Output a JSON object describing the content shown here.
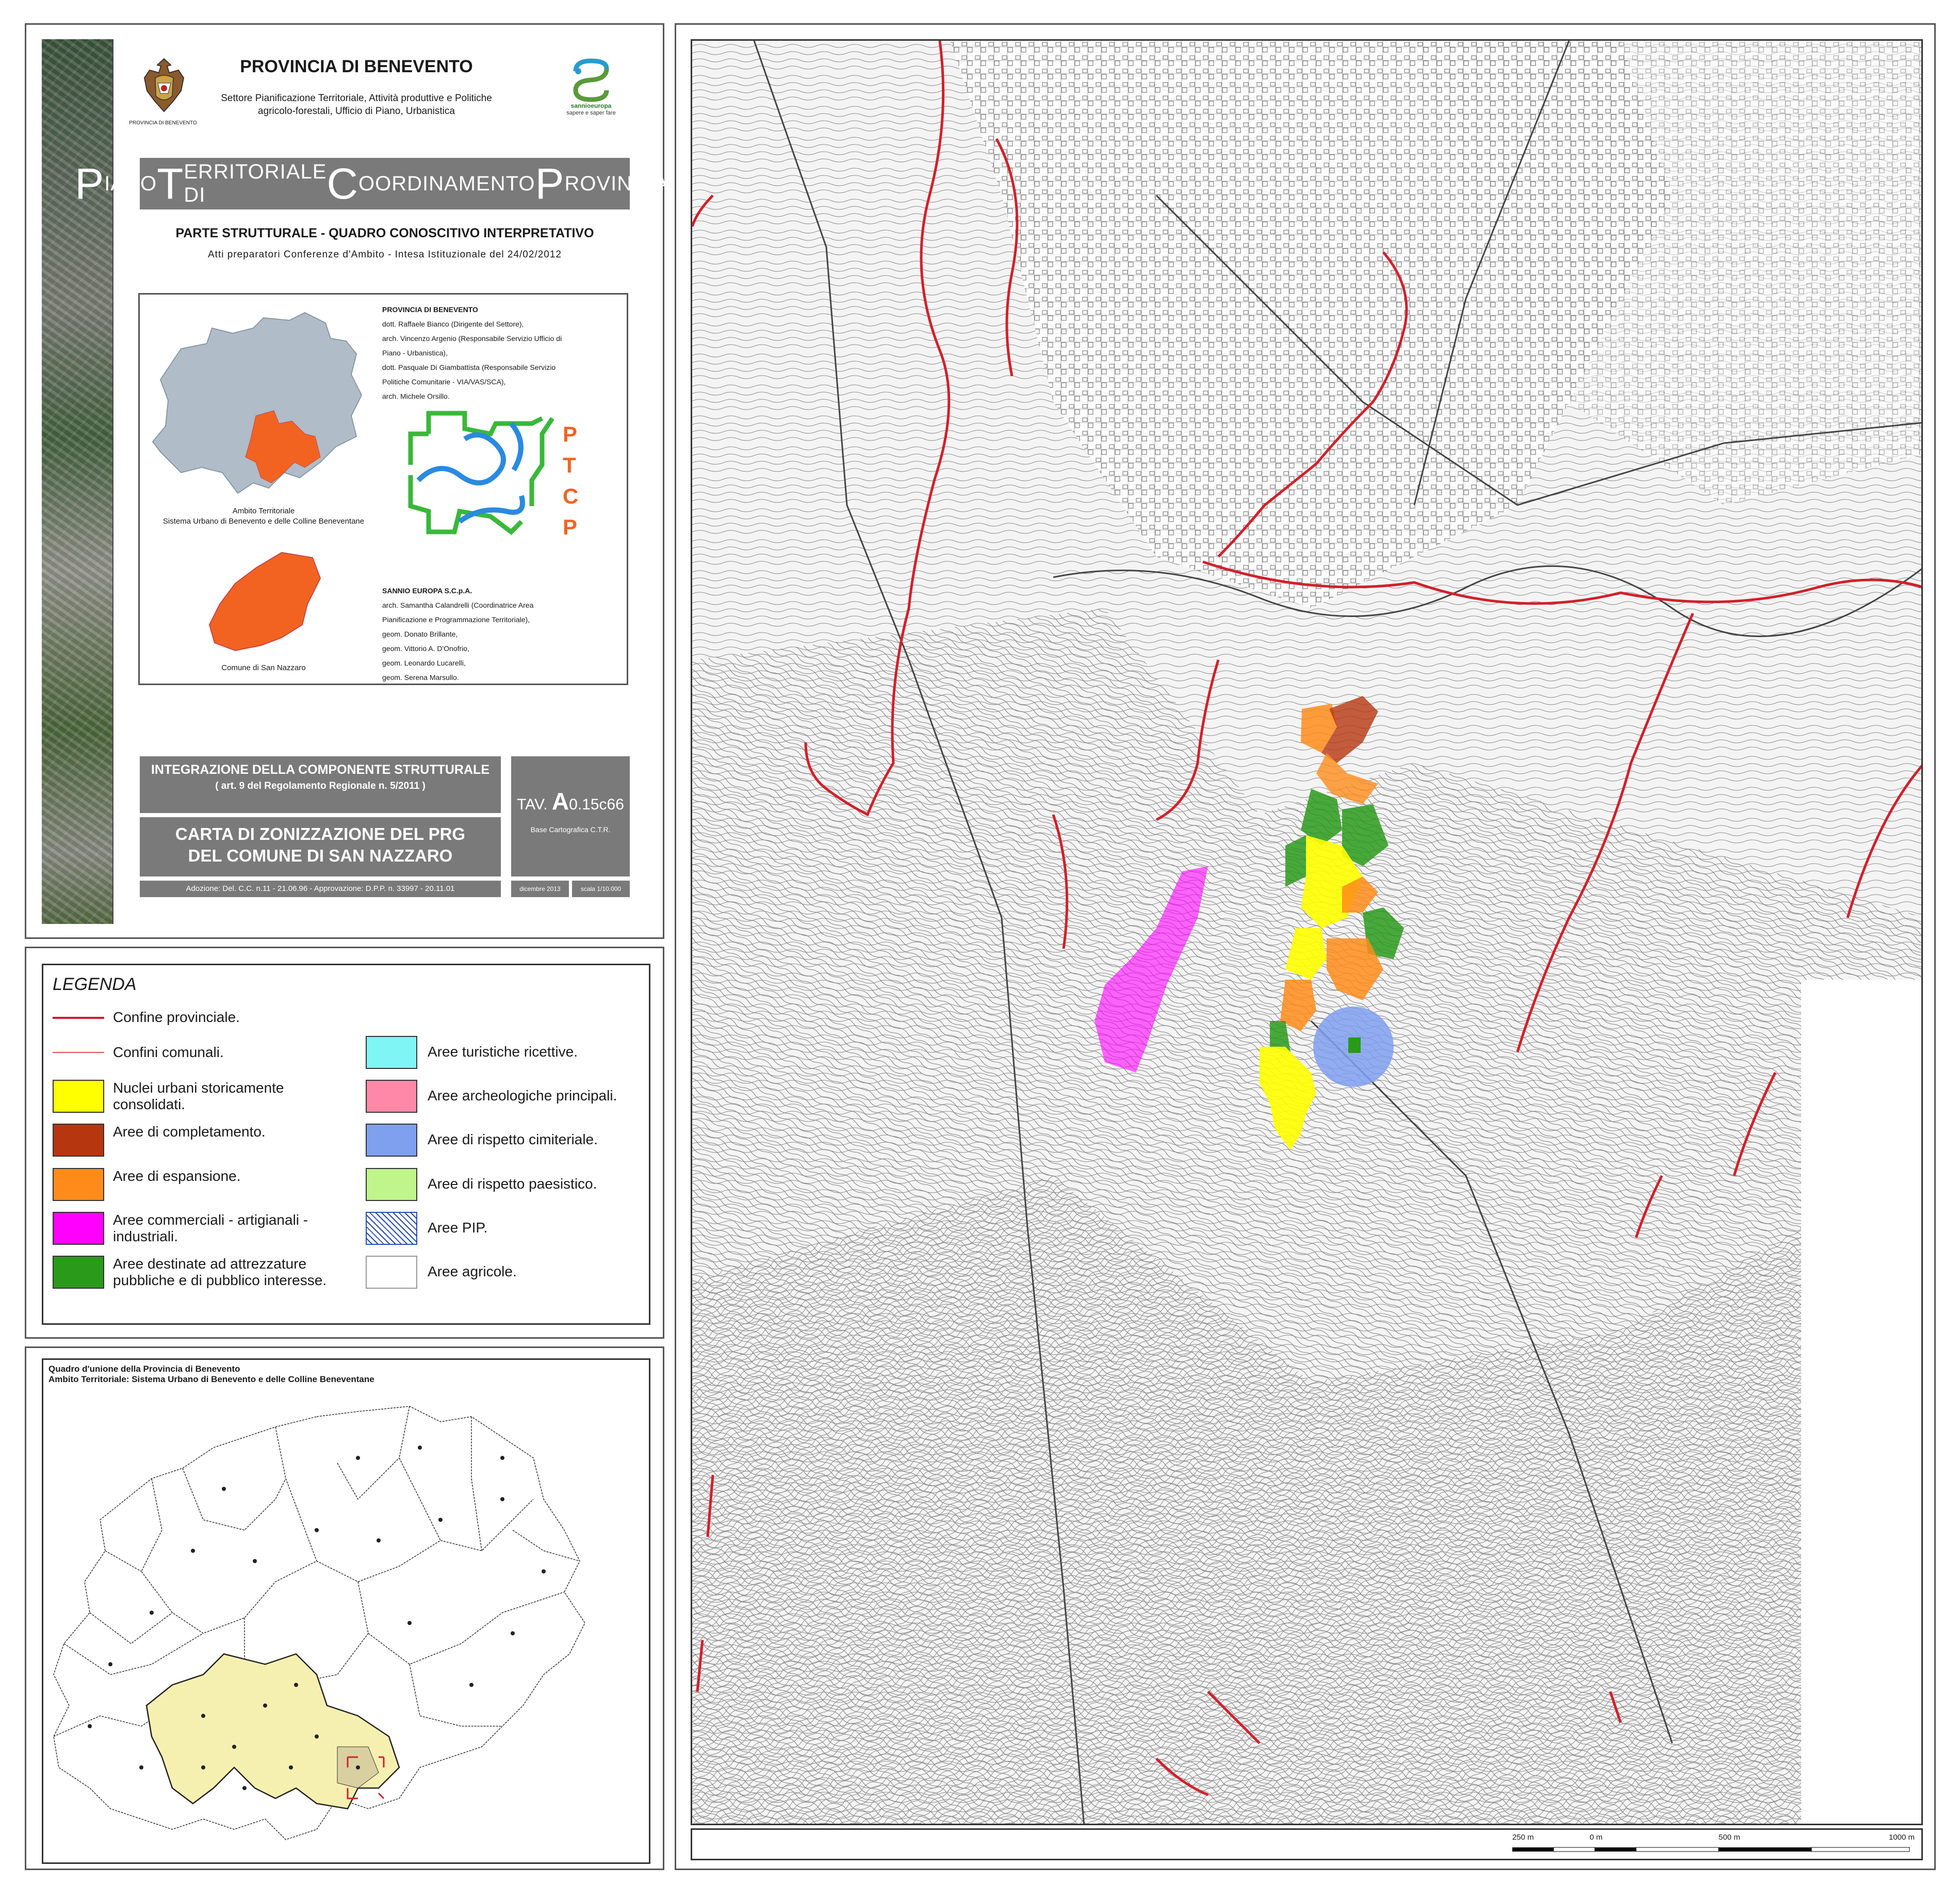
{
  "header": {
    "province": "PROVINCIA DI BENEVENTO",
    "department": "Settore Pianificazione Territoriale, Attività produttive e Politiche agricolo-forestali, Ufficio di Piano, Urbanistica",
    "crest_caption": "PROVINCIA DI BENEVENTO",
    "partner_logo_caption": "sannioeuropa",
    "partner_logo_motto": "sapere e saper fare"
  },
  "plan": {
    "banner": [
      {
        "initial": "P",
        "rest": "IANO "
      },
      {
        "initial": "T",
        "rest": "ERRITORIALE DI "
      },
      {
        "initial": "C",
        "rest": "OORDINAMENTO "
      },
      {
        "initial": "P",
        "rest": "ROVINCIALE"
      }
    ],
    "section_title": "PARTE STRUTTURALE - QUADRO CONOSCITIVO INTERPRETATIVO",
    "atti": "Atti preparatori Conferenze d'Ambito - Intesa Istituzionale del 24/02/2012"
  },
  "info_box": {
    "ambito_caption_1": "Ambito Territoriale",
    "ambito_caption_2": "Sistema Urbano di Benevento e delle Colline Beneventane",
    "comune_caption": "Comune di San Nazzaro",
    "ptcp_letters": [
      "P",
      "T",
      "C",
      "P"
    ],
    "province_credits_title": "PROVINCIA DI BENEVENTO",
    "province_credits": [
      "dott. Raffaele Bianco (Dirigente del Settore),",
      "arch. Vincenzo Argenio (Responsabile Servizio Ufficio di",
      "Piano - Urbanistica),",
      "dott. Pasquale Di Giambattista (Responsabile Servizio",
      "Politiche Comunitarie - VIA/VAS/SCA),",
      "arch. Michele Orsillo."
    ],
    "sannio_credits_title": "SANNIO EUROPA S.C.p.A.",
    "sannio_credits": [
      "arch. Samantha Calandrelli (Coordinatrice Area",
      "Pianificazione e Programmazione Territoriale),",
      "geom. Donato Brillante,",
      "geom. Vittorio A. D'Onofrio,",
      "geom. Leonardo Lucarelli,",
      "geom. Serena Marsullo."
    ]
  },
  "integration": {
    "title": "INTEGRAZIONE DELLA COMPONENTE STRUTTURALE",
    "article": "( art. 9 del Regolamento Regionale n. 5/2011 )",
    "carta_line1": "CARTA DI ZONIZZAZIONE DEL PRG",
    "carta_line2": "DEL COMUNE DI SAN NAZZARO",
    "adozione": "Adozione: Del. C.C. n.11 - 21.06.96 - Approvazione: D.P.P. n. 33997 - 20.11.01",
    "tav_prefix": "TAV.",
    "tav_code_big": "A",
    "tav_code_rest": "0.15c66",
    "base": "Base Cartografica C.T.R.",
    "date": "dicembre 2013",
    "scale": "scala 1/10.000"
  },
  "legend": {
    "title": "LEGENDA",
    "line_items": [
      {
        "label": "Confine provinciale.",
        "color": "#c8202a"
      },
      {
        "label": "Confini comunali.",
        "color": "#e0505a"
      }
    ],
    "left_items": [
      {
        "label": "Nuclei urbani storicamente consolidati.",
        "color": "#ffff00"
      },
      {
        "label": "Aree di completamento.",
        "color": "#b5360f"
      },
      {
        "label": "Aree di espansione.",
        "color": "#ff8c1a"
      },
      {
        "label": "Aree commerciali - artigianali - industriali.",
        "color": "#ff00ff"
      },
      {
        "label": "Aree destinate ad attrezzature pubbliche e di pubblico interesse.",
        "color": "#2a9a1a"
      }
    ],
    "right_items": [
      {
        "label": "Aree turistiche ricettive.",
        "color": "#7ff5f5"
      },
      {
        "label": "Aree archeologiche principali.",
        "color": "#ff88a8"
      },
      {
        "label": "Aree di rispetto cimiteriale.",
        "color": "#7f9fef"
      },
      {
        "label": "Aree di rispetto paesistico.",
        "color": "#bff58a"
      },
      {
        "label": "Aree PIP.",
        "color": "#ffffff"
      },
      {
        "label": "Aree agricole.",
        "color": "#ffffff"
      }
    ]
  },
  "inset": {
    "title_line1": "Quadro d'unione della Provincia di Benevento",
    "title_line2": "Ambito Territoriale: Sistema Urbano di Benevento e delle Colline Beneventane"
  },
  "scale_bar": {
    "labels": [
      "250 m",
      "0 m",
      "500 m",
      "1000 m"
    ]
  }
}
